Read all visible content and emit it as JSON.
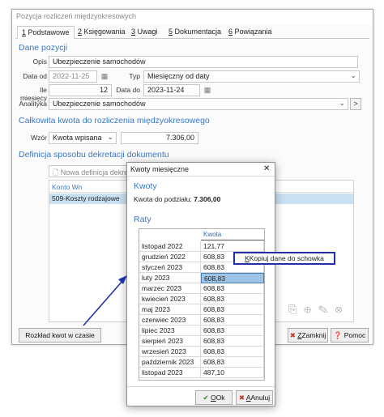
{
  "main": {
    "title": "Pozycja rozliczeń międzyokresowych",
    "tabs": [
      {
        "key": "1",
        "label": " Podstawowe"
      },
      {
        "key": "2",
        "label": " Księgowania"
      },
      {
        "key": "3",
        "label": " Uwagi"
      },
      {
        "key": "5",
        "label": " Dokumentacja"
      },
      {
        "key": "6",
        "label": " Powiązania"
      }
    ],
    "section_position": "Dane pozycji",
    "opis_label": "Opis",
    "opis_value": "Ubezpieczenie samochodów",
    "data_od_label": "Data od",
    "data_od_value": "2022-11-25",
    "typ_label": "Typ",
    "typ_value": "Miesięczny od daty",
    "ile_label": "Ile miesięcy",
    "ile_value": "12",
    "data_do_label": "Data do",
    "data_do_value": "2023-11-24",
    "analityka_label": "Analityka",
    "analityka_value": "Ubezpieczenie samochodów",
    "more_glyph": ">",
    "section_total": "Całkowita kwota do rozliczenia międzyokresowego",
    "wzor_label": "Wzór",
    "wzor_value": "Kwota wpisana",
    "total_value": "7.306,00",
    "section_decree": "Definicja sposobu dekretacji dokumentu",
    "new_def_placeholder": "Nowa definicja dekret",
    "col_konto": "Konto Wn",
    "row_konto": "509-Koszty rodzajowe",
    "btn_rozklad": "Rozkład kwot w czasie",
    "btn_zamknij": "Zamknij",
    "btn_zamknij_key": "Z",
    "btn_pomoc": "Pomoc"
  },
  "popup": {
    "title": "Kwoty miesięczne",
    "close_glyph": "✕",
    "section_kwoty": "Kwoty",
    "do_podzialu_label": "Kwota do podziału: ",
    "do_podzialu_value": "7.306,00",
    "section_raty": "Raty",
    "col_kwota": "Kwota",
    "rows": [
      {
        "month": "listopad 2022",
        "amount": "121,77"
      },
      {
        "month": "grudzień 2022",
        "amount": "608,83"
      },
      {
        "month": "styczeń 2023",
        "amount": "608,83"
      },
      {
        "month": "luty 2023",
        "amount": "608,83"
      },
      {
        "month": "marzec 2023",
        "amount": "608,83"
      },
      {
        "month": "kwiecień 2023",
        "amount": "608,83"
      },
      {
        "month": "maj 2023",
        "amount": "608,83"
      },
      {
        "month": "czerwiec 2023",
        "amount": "608,83"
      },
      {
        "month": "lipiec 2023",
        "amount": "608,83"
      },
      {
        "month": "sierpień 2023",
        "amount": "608,83"
      },
      {
        "month": "wrzesień 2023",
        "amount": "608,83"
      },
      {
        "month": "październik 2023",
        "amount": "608,83"
      },
      {
        "month": "listopad 2023",
        "amount": "487,10"
      }
    ],
    "selected_row": 3,
    "btn_ok": "Ok",
    "btn_ok_key": "O",
    "btn_anuluj": "Anuluj",
    "btn_anuluj_key": "A"
  },
  "context_menu": {
    "item": "Kopiuj dane do schowka",
    "item_key": "K"
  },
  "colors": {
    "section": "#3a78c4",
    "selected_row": "#9dc3e6",
    "highlight_row": "#c9dff2",
    "annotation": "#2230a8"
  }
}
